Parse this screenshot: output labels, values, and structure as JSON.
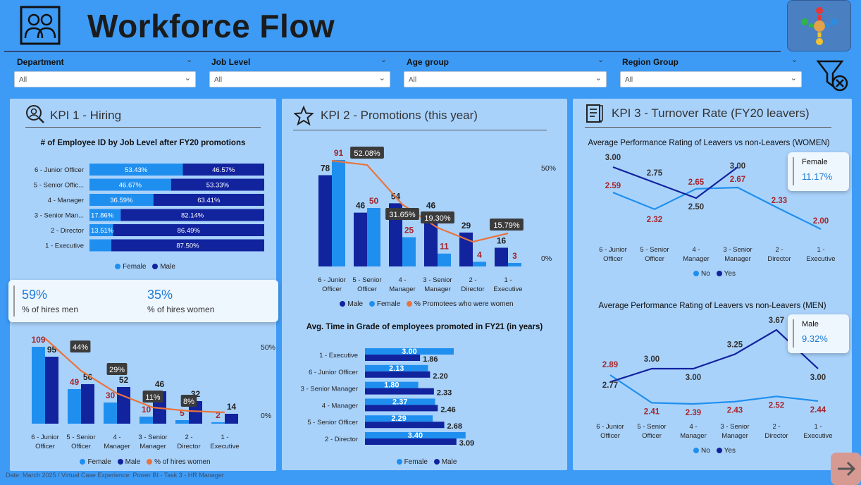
{
  "header": {
    "title": "Workforce Flow"
  },
  "filters": [
    {
      "label": "Department",
      "value": "All"
    },
    {
      "label": "Job Level",
      "value": "All"
    },
    {
      "label": "Age group",
      "value": "All"
    },
    {
      "label": "Region Group",
      "value": "All"
    }
  ],
  "kpi1": {
    "title": "KPI 1 - Hiring",
    "chart_title": "# of Employee ID by Job Level after FY20 promotions",
    "stacked": [
      {
        "label": "6 - Junior Officer",
        "female": "53.43%",
        "male": "46.57%",
        "f": 53.43
      },
      {
        "label": "5 - Senior Offic...",
        "female": "46.67%",
        "male": "53.33%",
        "f": 46.67
      },
      {
        "label": "4 - Manager",
        "female": "36.59%",
        "male": "63.41%",
        "f": 36.59
      },
      {
        "label": "3 - Senior Man...",
        "female": "17.86%",
        "male": "82.14%",
        "f": 17.86
      },
      {
        "label": "2 - Director",
        "female": "13.51%",
        "male": "86.49%",
        "f": 13.51
      },
      {
        "label": "1 - Executive",
        "female": "",
        "male": "87.50%",
        "f": 12.5
      }
    ],
    "legend": {
      "female": "Female",
      "male": "Male"
    },
    "card": {
      "men_value": "59%",
      "men_label": "% of hires men",
      "women_value": "35%",
      "women_label": "% of hires women"
    },
    "bars_axis_label": "50%",
    "bars_axis_zero": "0%",
    "bars": [
      {
        "cat1": "6 - Junior",
        "cat2": "Officer",
        "female": "109",
        "male": "95",
        "pct": "44%"
      },
      {
        "cat1": "5 - Senior",
        "cat2": "Officer",
        "female": "49",
        "male": "56",
        "pct": "29%"
      },
      {
        "cat1": "4 -",
        "cat2": "Manager",
        "female": "30",
        "male": "52",
        "pct": "11%"
      },
      {
        "cat1": "3 - Senior",
        "cat2": "Manager",
        "female": "10",
        "male": "46",
        "pct": "8%"
      },
      {
        "cat1": "2 -",
        "cat2": "Director",
        "female": "5",
        "male": "32",
        "pct": ""
      },
      {
        "cat1": "1 -",
        "cat2": "Executive",
        "female": "2",
        "male": "14",
        "pct": ""
      }
    ],
    "bars_legend": {
      "female": "Female",
      "male": "Male",
      "line": "% of hires women"
    }
  },
  "kpi2": {
    "title": "KPI 2 - Promotions (this year)",
    "axis_top": "50%",
    "axis_zero": "0%",
    "bars": [
      {
        "cat1": "6 - Junior",
        "cat2": "Officer",
        "male": "78",
        "female": "91",
        "pct": "52.08%"
      },
      {
        "cat1": "5 - Senior",
        "cat2": "Officer",
        "male": "46",
        "female": "50",
        "pct": "31.65%"
      },
      {
        "cat1": "4 -",
        "cat2": "Manager",
        "male": "54",
        "female": "25",
        "pct": "19.30%"
      },
      {
        "cat1": "3 - Senior",
        "cat2": "Manager",
        "male": "46",
        "female": "11",
        "pct": ""
      },
      {
        "cat1": "2 -",
        "cat2": "Director",
        "male": "29",
        "female": "4",
        "pct": ""
      },
      {
        "cat1": "1 -",
        "cat2": "Executive",
        "male": "16",
        "female": "3",
        "pct": "15.79%"
      }
    ],
    "legend": {
      "male": "Male",
      "female": "Female",
      "line": "% Promotees who were women"
    },
    "time_title": "Avg. Time in Grade of employees promoted in FY21 (in years)",
    "time_rows": [
      {
        "label": "1 - Executive",
        "female": "3.00",
        "male": "1.86"
      },
      {
        "label": "6 - Junior Officer",
        "female": "2.13",
        "male": "2.20"
      },
      {
        "label": "3 - Senior Manager",
        "female": "1.80",
        "male": "2.33"
      },
      {
        "label": "4 - Manager",
        "female": "2.37",
        "male": "2.46"
      },
      {
        "label": "5 - Senior Officer",
        "female": "2.29",
        "male": "2.68"
      },
      {
        "label": "2 - Director",
        "female": "3.40",
        "male": "3.09"
      }
    ],
    "time_legend": {
      "female": "Female",
      "male": "Male"
    }
  },
  "kpi3": {
    "title": "KPI 3 - Turnover Rate (FY20 leavers)",
    "women_title": "Average Performance Rating of Leavers vs non-Leavers (WOMEN)",
    "men_title": "Average Performance Rating of Leavers vs non-Leavers (MEN)",
    "categories": [
      {
        "c1": "6 - Junior",
        "c2": "Officer"
      },
      {
        "c1": "5 - Senior",
        "c2": "Officer"
      },
      {
        "c1": "4 -",
        "c2": "Manager"
      },
      {
        "c1": "3 - Senior",
        "c2": "Manager"
      },
      {
        "c1": "2 -",
        "c2": "Director"
      },
      {
        "c1": "1 -",
        "c2": "Executive"
      }
    ],
    "women_no": [
      "2.59",
      "2.32",
      "2.65",
      "2.67",
      "2.33",
      "2.00"
    ],
    "women_yes": [
      "3.00",
      "2.75",
      "2.50",
      "3.00",
      "",
      ""
    ],
    "men_no": [
      "2.89",
      "2.41",
      "2.39",
      "2.43",
      "2.52",
      "2.44"
    ],
    "men_yes": [
      "2.77",
      "3.00",
      "3.00",
      "3.25",
      "3.67",
      "3.00"
    ],
    "legend": {
      "no": "No",
      "yes": "Yes"
    },
    "female_card": {
      "label": "Female",
      "value": "11.17%"
    },
    "male_card": {
      "label": "Male",
      "value": "9.32%"
    }
  },
  "footer": "Date: March 2025 / Virtual Case Experience: Power BI - Task 3 - HR Manager",
  "colors": {
    "female": "#1f8fef",
    "male": "#12239e",
    "line": "#e8743b",
    "value_red": "#a4262c"
  }
}
